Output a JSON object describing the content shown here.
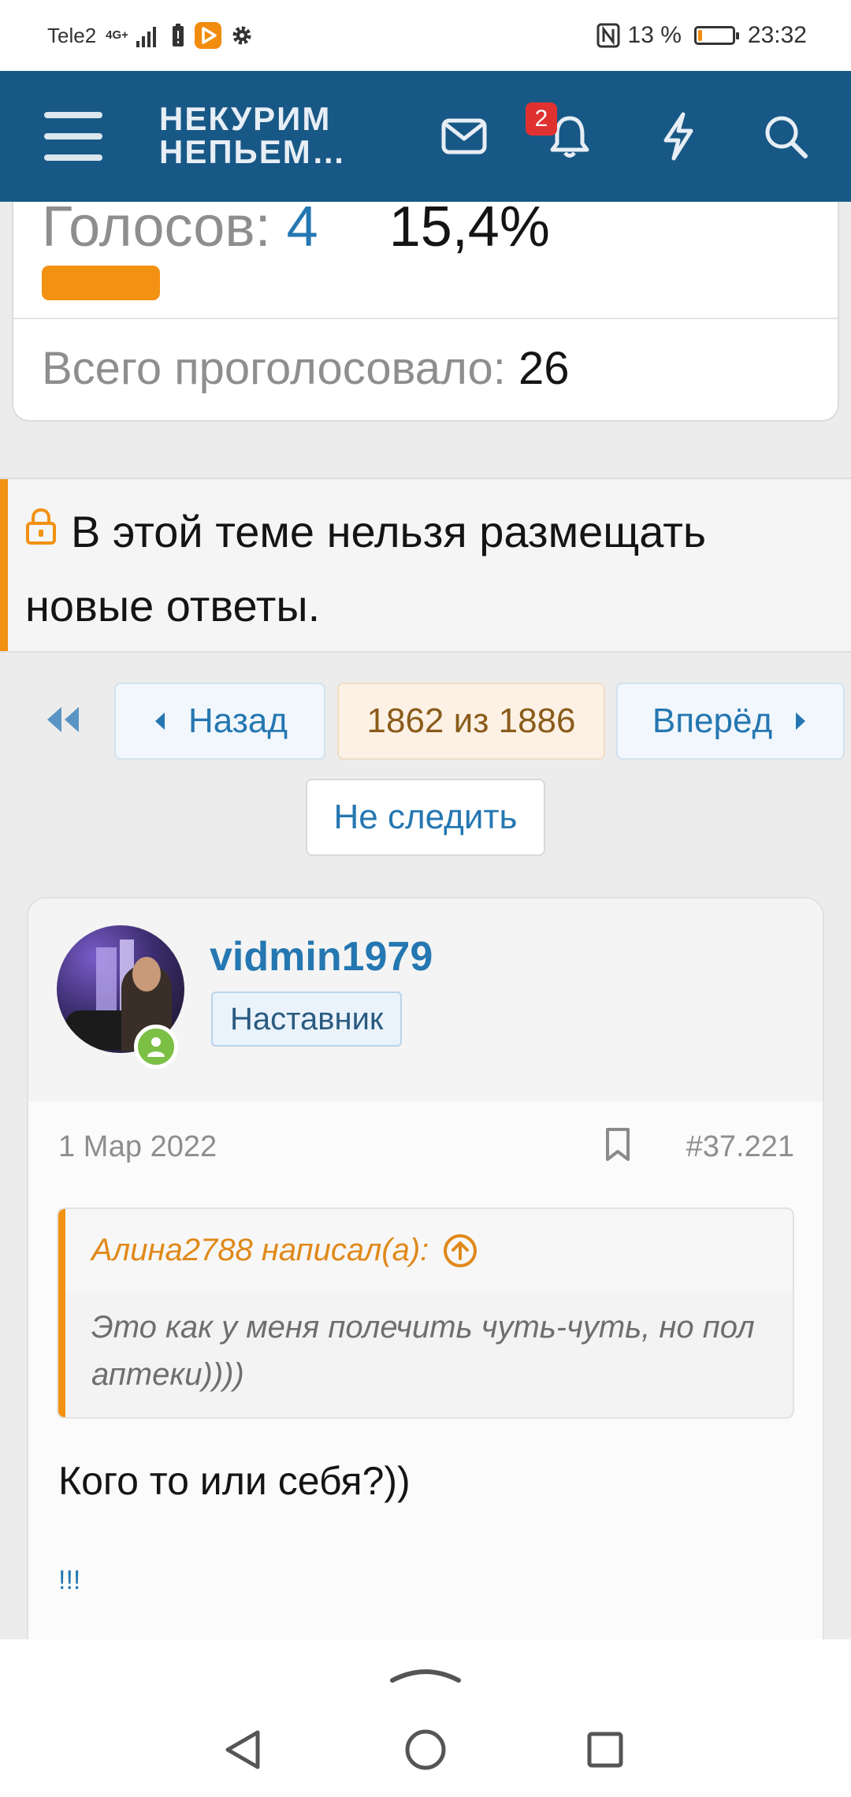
{
  "status_bar": {
    "carrier": "Tele2",
    "network": "4G+",
    "battery_percent": "13 %",
    "battery_level": 0.13,
    "time": "23:32"
  },
  "header": {
    "logo_line1": "НЕКУРИМ",
    "logo_line2": "НЕПЬЕМ…",
    "notification_count": "2",
    "icons": [
      "menu-icon",
      "envelope-icon",
      "bell-icon",
      "lightning-icon",
      "search-icon"
    ]
  },
  "poll": {
    "votes_label": "Голосов:",
    "votes_value": "4",
    "percent": "15,4%",
    "bar_fraction": 0.154,
    "total_label": "Всего проголосовало:",
    "total_value": "26"
  },
  "locked_notice": {
    "text": "В этой теме нельзя размещать новые ответы."
  },
  "pagination": {
    "prev_label": "Назад",
    "current": "1862 из 1886",
    "next_label": "Вперёд",
    "unwatch_label": "Не следить"
  },
  "post": {
    "username": "vidmin1979",
    "role": "Наставник",
    "date": "1 Мар 2022",
    "number": "#37.221",
    "quote_author": "Алина2788 написал(а):",
    "quote_text": "Это как у меня полечить чуть-чуть, но пол аптеки))))",
    "body": "Кого то или себя?))",
    "extra": "!!!"
  },
  "colors": {
    "header_bg": "#185886",
    "accent_orange": "#f29112",
    "link_blue": "#2577b1"
  }
}
